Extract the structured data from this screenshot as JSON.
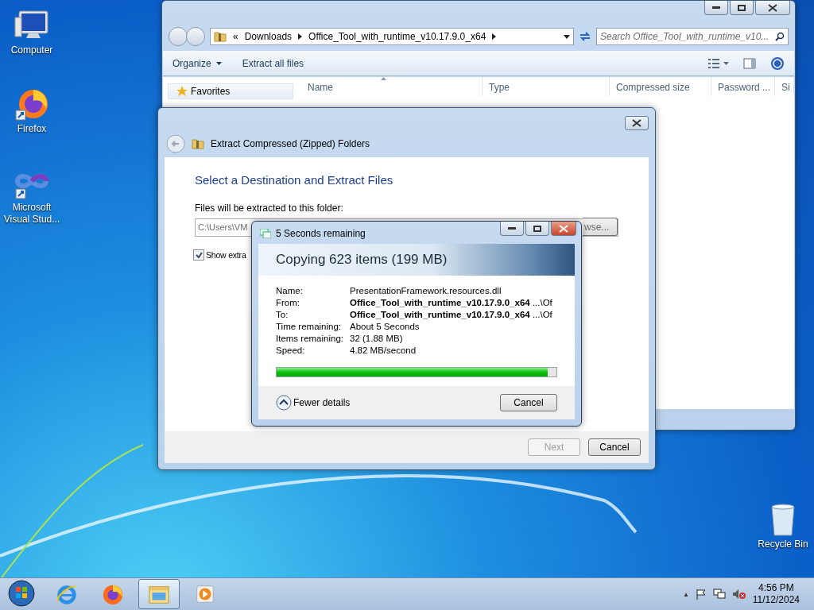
{
  "desktop_icons": [
    {
      "kind": "computer",
      "label": "Computer"
    },
    {
      "kind": "firefox",
      "label": "Firefox"
    },
    {
      "kind": "visual-studio",
      "label": "Microsoft Visual Stud..."
    }
  ],
  "recycle_bin": {
    "label": "Recycle Bin"
  },
  "explorer": {
    "crumbs": [
      "Downloads",
      "Office_Tool_with_runtime_v10.17.9.0_x64"
    ],
    "crumb_lead": "«",
    "search_placeholder": "Search Office_Tool_with_runtime_v10...",
    "toolbar": [
      {
        "label": "Organize",
        "dropdown": true
      },
      {
        "label": "Extract all files",
        "dropdown": false
      }
    ],
    "nav": [
      {
        "label": "Favorites"
      }
    ],
    "columns": [
      "Name",
      "Type",
      "Compressed size",
      "Password ...",
      "Si"
    ]
  },
  "extract_dialog": {
    "title": "Extract Compressed (Zipped) Folders",
    "heading": "Select a Destination and Extract Files",
    "folder_label": "Files will be extracted to this folder:",
    "path_value": "C:\\Users\\VM",
    "browse_label": "wse...",
    "checkbox": {
      "label": "Show extra",
      "checked": true
    },
    "buttons": [
      {
        "label": "Next",
        "disabled": true
      },
      {
        "label": "Cancel",
        "disabled": false
      }
    ]
  },
  "copy_dialog": {
    "title": "5 Seconds remaining",
    "heading": "Copying 623 items (199 MB)",
    "details": [
      {
        "label": "Name:",
        "value": "PresentationFramework.resources.dll"
      },
      {
        "label": "From:",
        "value": "**Office_Tool_with_runtime_v10.17.9.0_x64** ...\\Of"
      },
      {
        "label": "To:",
        "value": "**Office_Tool_with_runtime_v10.17.9.0_x64** ...\\Of"
      },
      {
        "label": "Time remaining:",
        "value": "About 5 Seconds"
      },
      {
        "label": "Items remaining:",
        "value": "32 (1.88 MB)"
      },
      {
        "label": "Speed:",
        "value": "4.82 MB/second"
      }
    ],
    "progress": {
      "level": 0.97
    },
    "toggle_label": "Fewer details",
    "cancel_label": "Cancel"
  },
  "taskbar": {
    "items": [
      {
        "kind": "internet-explorer",
        "active": false
      },
      {
        "kind": "firefox",
        "active": false
      },
      {
        "kind": "explorer",
        "active": true
      },
      {
        "kind": "media-player",
        "active": false
      }
    ],
    "tray_arrow": "▲",
    "time": "4:56 PM",
    "date": "11/12/2024"
  }
}
